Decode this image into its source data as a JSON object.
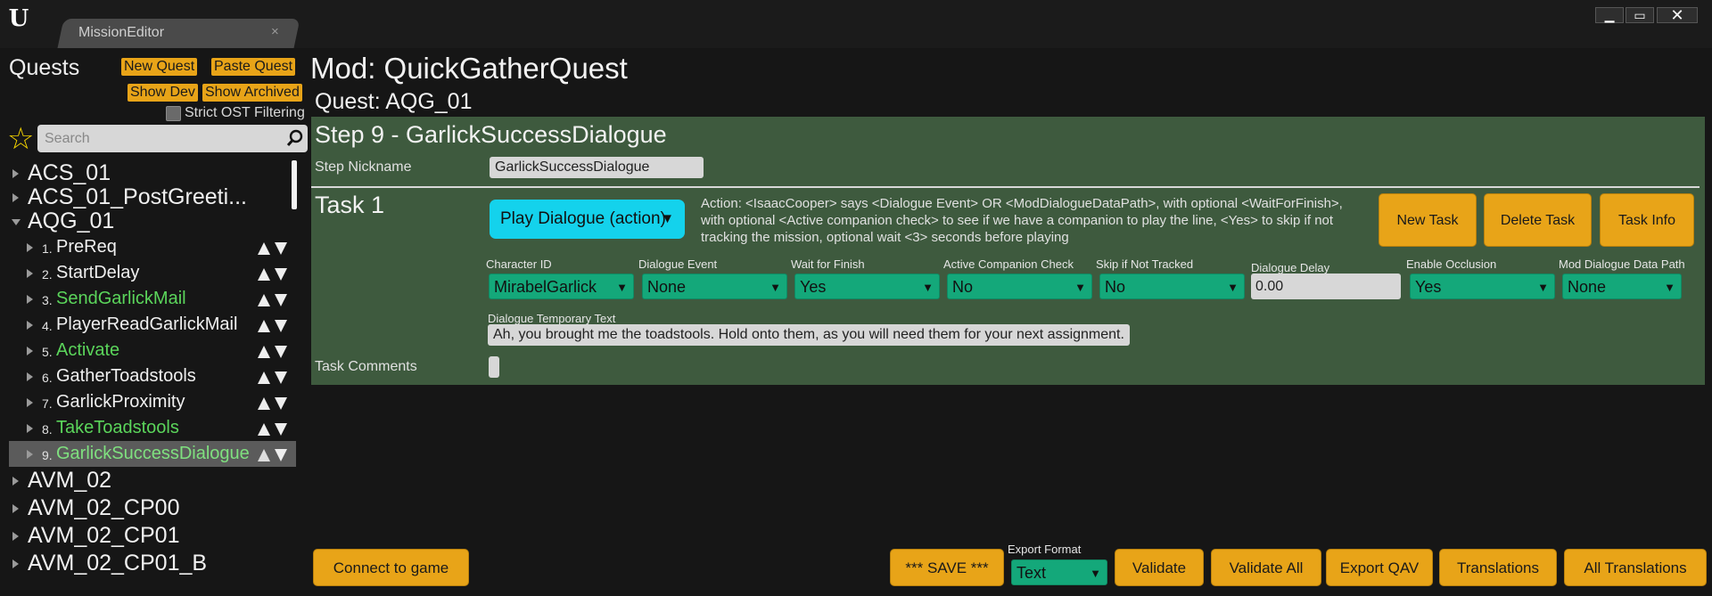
{
  "window": {
    "tab_label": "MissionEditor",
    "tab_close": "×",
    "minimize": "▁",
    "maximize": "▭",
    "close": "✕"
  },
  "sidebar": {
    "title": "Quests",
    "new_quest": "New Quest",
    "paste_quest": "Paste Quest",
    "show_dev": "Show Dev",
    "show_archived": "Show Archived",
    "strict_filter_label": "Strict OST Filtering",
    "search_placeholder": "Search",
    "tree": [
      {
        "label": "ACS_01",
        "expanded": false
      },
      {
        "label": "ACS_01_PostGreeti...",
        "expanded": false
      },
      {
        "label": "AQG_01",
        "expanded": true
      },
      {
        "label": "AVM_02",
        "expanded": false
      },
      {
        "label": "AVM_02_CP00",
        "expanded": false
      },
      {
        "label": "AVM_02_CP01",
        "expanded": false
      },
      {
        "label": "AVM_02_CP01_B",
        "expanded": false
      }
    ],
    "steps": [
      {
        "num": "1.",
        "label": "PreReq"
      },
      {
        "num": "2.",
        "label": "StartDelay"
      },
      {
        "num": "3.",
        "label": "SendGarlickMail"
      },
      {
        "num": "4.",
        "label": "PlayerReadGarlickMail"
      },
      {
        "num": "5.",
        "label": "Activate"
      },
      {
        "num": "6.",
        "label": "GatherToadstools"
      },
      {
        "num": "7.",
        "label": "GarlickProximity"
      },
      {
        "num": "8.",
        "label": "TakeToadstools"
      },
      {
        "num": "9.",
        "label": "GarlickSuccessDialogue"
      }
    ]
  },
  "main": {
    "mod_title": "Mod: QuickGatherQuest",
    "quest_title": "Quest: AQG_01",
    "step_heading": "Step 9 - GarlickSuccessDialogue",
    "nickname_label": "Step Nickname",
    "nickname_value": "GarlickSuccessDialogue",
    "task_title": "Task 1",
    "task_type": "Play Dialogue (action)",
    "action_text": "Action: <IsaacCooper> says <Dialogue Event> OR <ModDialogueDataPath>, with optional <WaitForFinish>, with optional <Active companion check> to see if we have a companion to play the line, <Yes> to skip if not tracking the mission, optional wait <3> seconds before playing",
    "new_task": "New Task",
    "delete_task": "Delete Task",
    "task_info": "Task Info",
    "fields": {
      "character_id": {
        "label": "Character ID",
        "value": "MirabelGarlick"
      },
      "dialogue_event": {
        "label": "Dialogue Event",
        "value": "None"
      },
      "wait_for_finish": {
        "label": "Wait for Finish",
        "value": "Yes"
      },
      "active_companion": {
        "label": "Active Companion Check",
        "value": "No"
      },
      "skip_not_tracked": {
        "label": "Skip if Not Tracked",
        "value": "No"
      },
      "dialogue_delay": {
        "label": "Dialogue Delay",
        "value": "0.00"
      },
      "enable_occlusion": {
        "label": "Enable Occlusion",
        "value": "Yes"
      },
      "mod_dialogue_path": {
        "label": "Mod Dialogue Data Path",
        "value": "None"
      }
    },
    "temp_text_label": "Dialogue Temporary Text",
    "temp_text_value": "Ah, you brought me the toadstools. Hold onto them, as you will need them for your next assignment.",
    "comments_label": "Task Comments"
  },
  "footer": {
    "connect": "Connect to game",
    "save": "*** SAVE ***",
    "export_format_label": "Export Format",
    "export_format_value": "Text",
    "validate": "Validate",
    "validate_all": "Validate All",
    "export_qav": "Export QAV",
    "translations": "Translations",
    "all_translations": "All Translations"
  },
  "colors": {
    "accent_orange": "#e8a418",
    "panel_green": "#3e5a3e",
    "select_green": "#14a87a",
    "cyan_button": "#14d2ec",
    "highlight_text_green": "#5bd55b"
  }
}
